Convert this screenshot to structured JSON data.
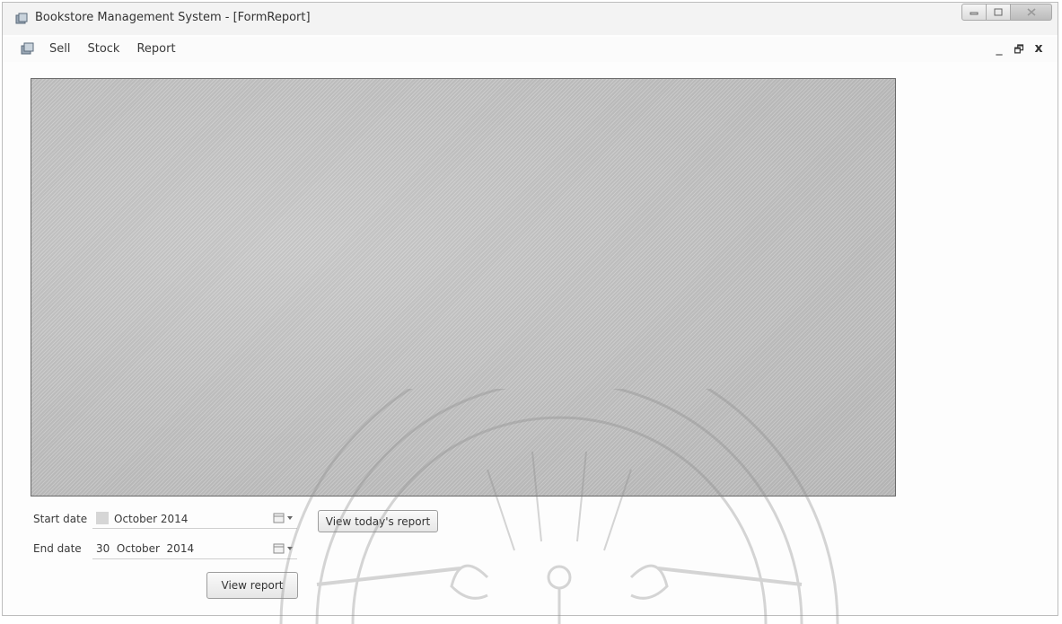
{
  "window": {
    "title": "Bookstore Management System - [FormReport]",
    "caption_buttons": [
      "minimize-icon",
      "maximize-icon",
      "close-icon"
    ]
  },
  "menu": {
    "items": [
      {
        "label": "Sell"
      },
      {
        "label": "Stock"
      },
      {
        "label": "Report"
      }
    ],
    "mdi_minimize": "_",
    "mdi_restore": "🗗",
    "mdi_close": "x"
  },
  "filters": {
    "start_label": "Start date",
    "start_value": "October  2014",
    "end_label": "End date",
    "end_value": "30  October  2014",
    "today_button": "View today's report",
    "view_button": "View report"
  },
  "colors": {
    "report_area": "#c6c6c6",
    "watermark": "#8a8a8a"
  }
}
